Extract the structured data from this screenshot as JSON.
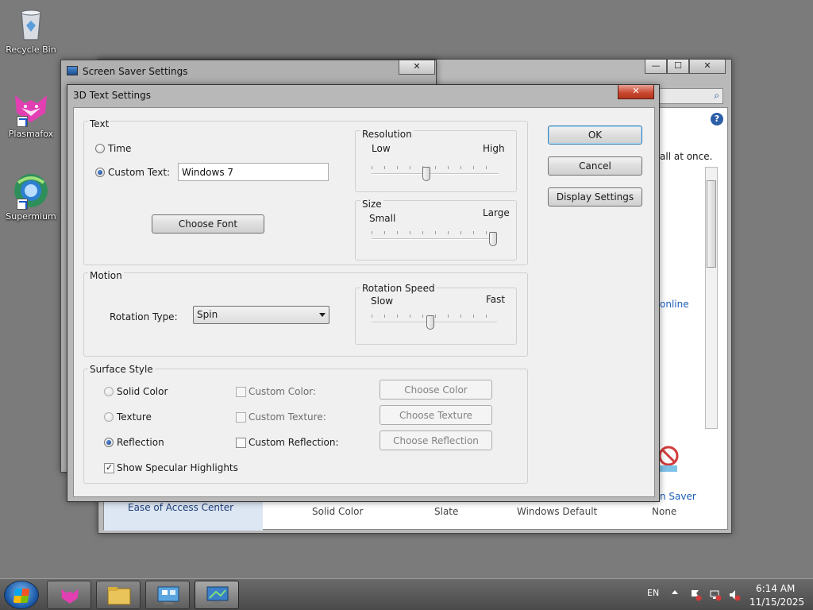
{
  "desktop": {
    "icons": [
      {
        "label": "Recycle Bin",
        "icon": "recycle-bin-icon"
      },
      {
        "label": "Plasmafox",
        "icon": "plasmafox-icon"
      },
      {
        "label": "Supermium",
        "icon": "supermium-icon"
      }
    ]
  },
  "control_panel": {
    "visible_text": {
      "all_at_once": "all at once.",
      "online": "online",
      "ease_of_access": "Ease of Access Center",
      "screen_saver": "n Saver",
      "themes": [
        "Solid Color",
        "Slate",
        "Windows Default",
        "None"
      ]
    }
  },
  "screen_saver_window": {
    "title": "Screen Saver Settings",
    "close_label": "✕"
  },
  "dialog": {
    "title": "3D Text Settings",
    "close_label": "✕",
    "text_group": {
      "label": "Text",
      "time_label": "Time",
      "custom_text_label": "Custom Text:",
      "custom_text_value": "Windows 7",
      "choose_font_label": "Choose Font"
    },
    "resolution": {
      "label": "Resolution",
      "low_label": "Low",
      "high_label": "High",
      "value": 0.43
    },
    "size": {
      "label": "Size",
      "small_label": "Small",
      "large_label": "Large",
      "value": 1.0
    },
    "motion": {
      "label": "Motion",
      "rotation_type_label": "Rotation Type:",
      "rotation_type_value": "Spin"
    },
    "rotation_speed": {
      "label": "Rotation Speed",
      "slow_label": "Slow",
      "fast_label": "Fast",
      "value": 0.47
    },
    "surface": {
      "label": "Surface Style",
      "solid_color_label": "Solid Color",
      "texture_label": "Texture",
      "reflection_label": "Reflection",
      "custom_color_label": "Custom Color:",
      "custom_texture_label": "Custom Texture:",
      "custom_reflection_label": "Custom Reflection:",
      "choose_color_label": "Choose Color",
      "choose_texture_label": "Choose Texture",
      "choose_reflection_label": "Choose Reflection",
      "specular_label": "Show Specular Highlights"
    },
    "buttons": {
      "ok_label": "OK",
      "cancel_label": "Cancel",
      "display_settings_label": "Display Settings"
    }
  },
  "taskbar": {
    "language": "EN",
    "time": "6:14 AM",
    "date": "11/15/2025"
  },
  "colors": {
    "accent": "#3c7fb1",
    "desktop": "#7b7b7b"
  }
}
